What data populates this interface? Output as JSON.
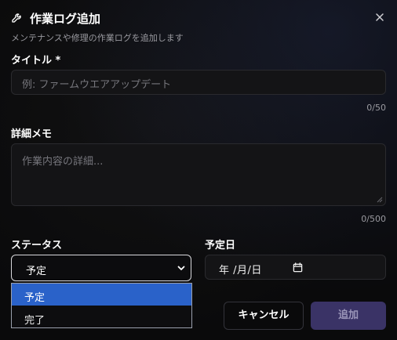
{
  "dialog": {
    "title": "作業ログ追加",
    "subtitle": "メンテナンスや修理の作業ログを追加します",
    "header_icon": "wrench-icon",
    "close_icon": "close-icon"
  },
  "title_field": {
    "label": "タイトル *",
    "placeholder": "例: ファームウエアアップデート",
    "value": "",
    "counter": "0/50"
  },
  "memo_field": {
    "label": "詳細メモ",
    "placeholder": "作業内容の詳細...",
    "value": "",
    "counter": "0/500"
  },
  "status_field": {
    "label": "ステータス",
    "selected": "予定",
    "options": [
      "予定",
      "完了"
    ],
    "highlighted_index": 0
  },
  "date_field": {
    "label": "予定日",
    "value": "年 /月/日",
    "icon": "calendar-icon"
  },
  "buttons": {
    "cancel": "キャンセル",
    "add": "追加"
  },
  "colors": {
    "background": "#0a0a0b",
    "accent": "#2a62c9",
    "add_button_bg": "#3a3366",
    "add_button_text": "#9a95b8"
  }
}
